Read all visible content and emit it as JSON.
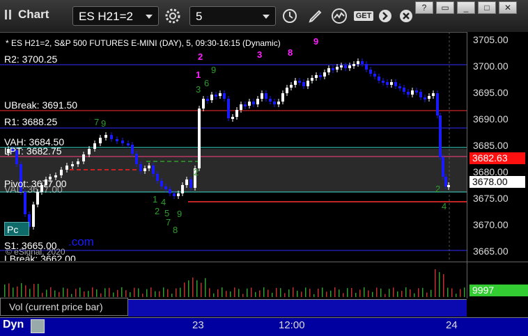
{
  "window": {
    "title": "Chart"
  },
  "toolbar": {
    "symbol": "ES H21=2",
    "interval": "5",
    "get_label": "GET"
  },
  "chart": {
    "header": "* ES H21=2, S&P 500 FUTURES E-MINI (DAY), 5, 09:30-16:15 (Dynamic)",
    "watermark_text": "© eSignal, 2020",
    "watermark_com": ".com",
    "watermark_pc": "Pc",
    "price_ticks": [
      "3705.00",
      "3700.00",
      "3695.00",
      "3690.00",
      "3685.00",
      "3680.00",
      "3675.00",
      "3670.00",
      "3665.00"
    ],
    "levels": {
      "r2": "R2: 3700.25",
      "ubreak": "UBreak: 3691.50",
      "r1": "R1: 3688.25",
      "vah": "VAH: 3684.50",
      "lpt": "LPT: 3682.75",
      "pivot": "Pivot: 3677.00",
      "val": "VAL: 3677.00",
      "s1": "S1: 3665.00",
      "lbreak": "LBreak: 3662.00"
    },
    "current_price": "3678.00",
    "red_tag": "3682.63",
    "colors": {
      "up": "#ffffff",
      "down": "#1a1aff",
      "red_level": "#ff3030",
      "blue_level": "#3030ff",
      "cyan_level": "#40e0d0",
      "accent": "#ff00ff"
    },
    "markers": {
      "m2": "2",
      "m1": "1",
      "m3": "3",
      "m8": "8",
      "m9": "9",
      "g6": "6",
      "g7": "7",
      "g3": "3",
      "g2": "2",
      "g4": "4",
      "g1": "1",
      "g5": "5"
    }
  },
  "volume": {
    "value": "9997",
    "study_label": "Vol (current price bar)",
    "close_glyph": "×"
  },
  "time_axis": {
    "labels": [
      "23",
      "12:00",
      "24"
    ]
  },
  "footer": {
    "dyn": "Dyn"
  }
}
